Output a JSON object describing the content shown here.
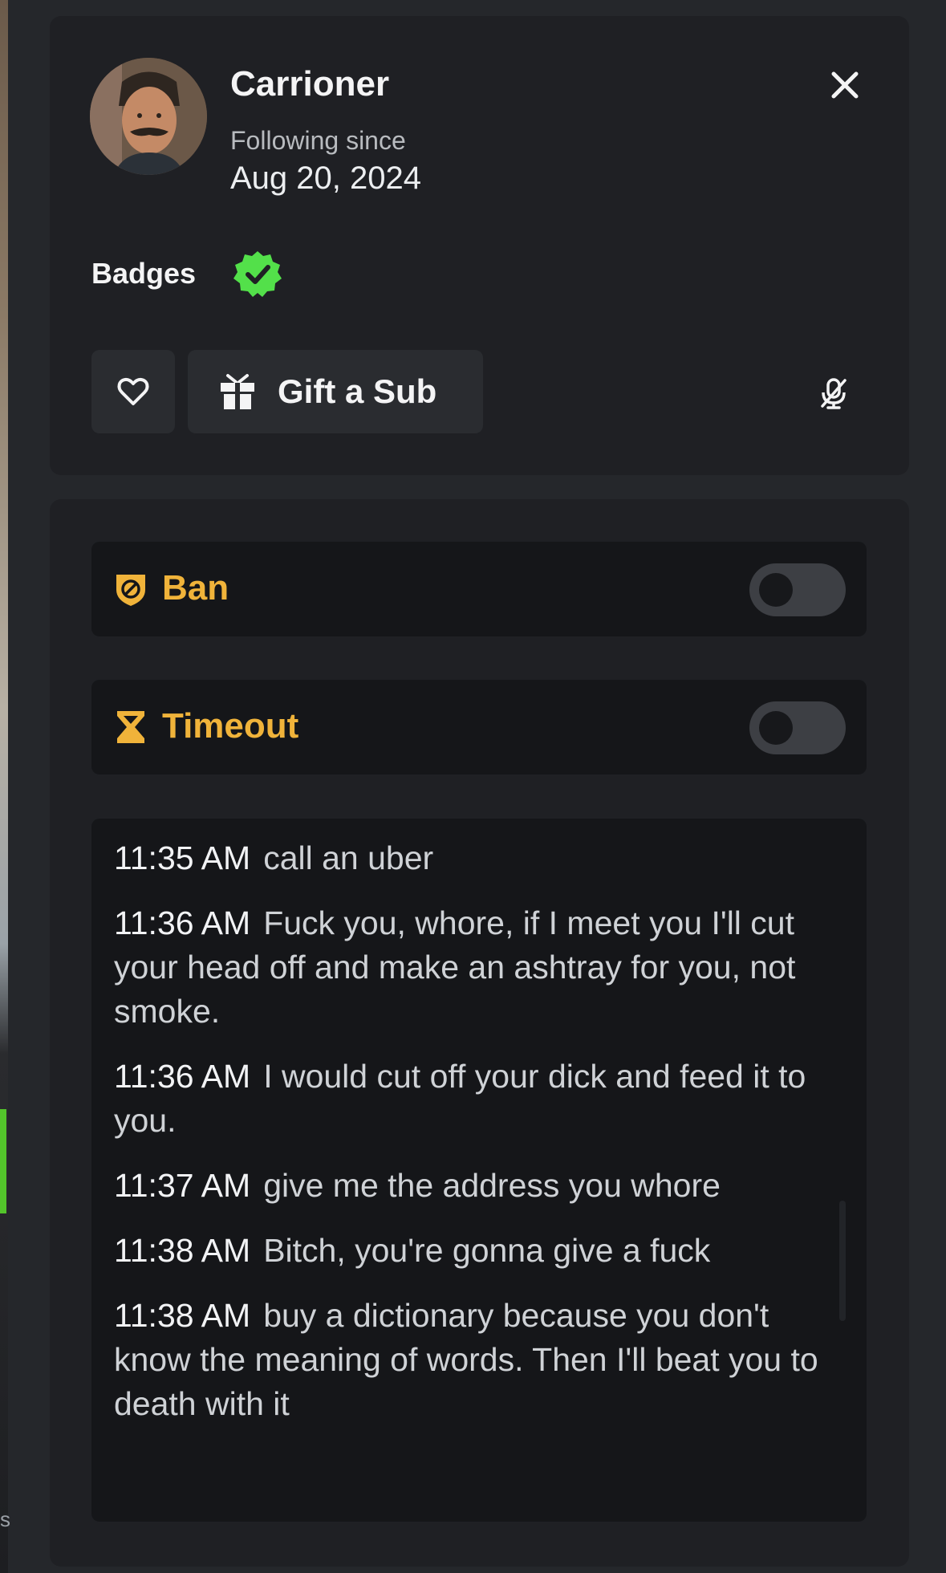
{
  "profile": {
    "username": "Carrioner",
    "following_label": "Following since",
    "following_date": "Aug 20, 2024",
    "badges_label": "Badges",
    "badge_icon": "verified-check-icon",
    "gift_label": "Gift a Sub"
  },
  "moderation": {
    "ban_label": "Ban",
    "ban_enabled": false,
    "timeout_label": "Timeout",
    "timeout_enabled": false
  },
  "messages": [
    {
      "time": "11:35 AM",
      "text": "call an uber"
    },
    {
      "time": "11:36 AM",
      "text": "Fuck you, whore, if I meet you I'll cut your head off and make an ashtray for you, not smoke."
    },
    {
      "time": "11:36 AM",
      "text": "I would cut off your dick and feed it to you."
    },
    {
      "time": "11:37 AM",
      "text": "give me the address you whore"
    },
    {
      "time": "11:38 AM",
      "text": "Bitch, you're gonna give a fuck"
    },
    {
      "time": "11:38 AM",
      "text": "buy a dictionary because you don't know the meaning of words. Then I'll beat you to death with it"
    }
  ],
  "colors": {
    "accent_orange": "#f0b33a",
    "badge_green": "#53e04a",
    "panel_bg": "#1f2024",
    "row_bg": "#151619"
  },
  "background": {
    "left_edge_char": "s"
  }
}
